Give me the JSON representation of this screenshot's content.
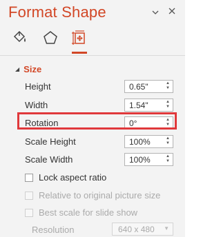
{
  "pane": {
    "title": "Format Shape",
    "dropdown_icon": "chevron-down-icon",
    "close_icon": "close-icon",
    "tabs": [
      {
        "icon": "fill-line-icon"
      },
      {
        "icon": "effects-pentagon-icon"
      },
      {
        "icon": "size-properties-icon",
        "active": true
      }
    ]
  },
  "size_section": {
    "title": "Size",
    "fields": {
      "height": {
        "label": "Height",
        "value": "0.65\""
      },
      "width": {
        "label": "Width",
        "value": "1.54\""
      },
      "rotation": {
        "label": "Rotation",
        "value": "0°"
      },
      "scale_height": {
        "label": "Scale Height",
        "value": "100%"
      },
      "scale_width": {
        "label": "Scale Width",
        "value": "100%"
      }
    },
    "checkboxes": {
      "lock_aspect": {
        "label": "Lock aspect ratio",
        "checked": false,
        "enabled": true
      },
      "relative_original": {
        "label": "Relative to original picture size",
        "checked": false,
        "enabled": false
      },
      "best_scale": {
        "label": "Best scale for slide show",
        "checked": false,
        "enabled": false
      }
    },
    "resolution": {
      "label": "Resolution",
      "value": "640 x 480",
      "enabled": false
    }
  },
  "colors": {
    "accent": "#d24726",
    "highlight": "#e0383b"
  }
}
